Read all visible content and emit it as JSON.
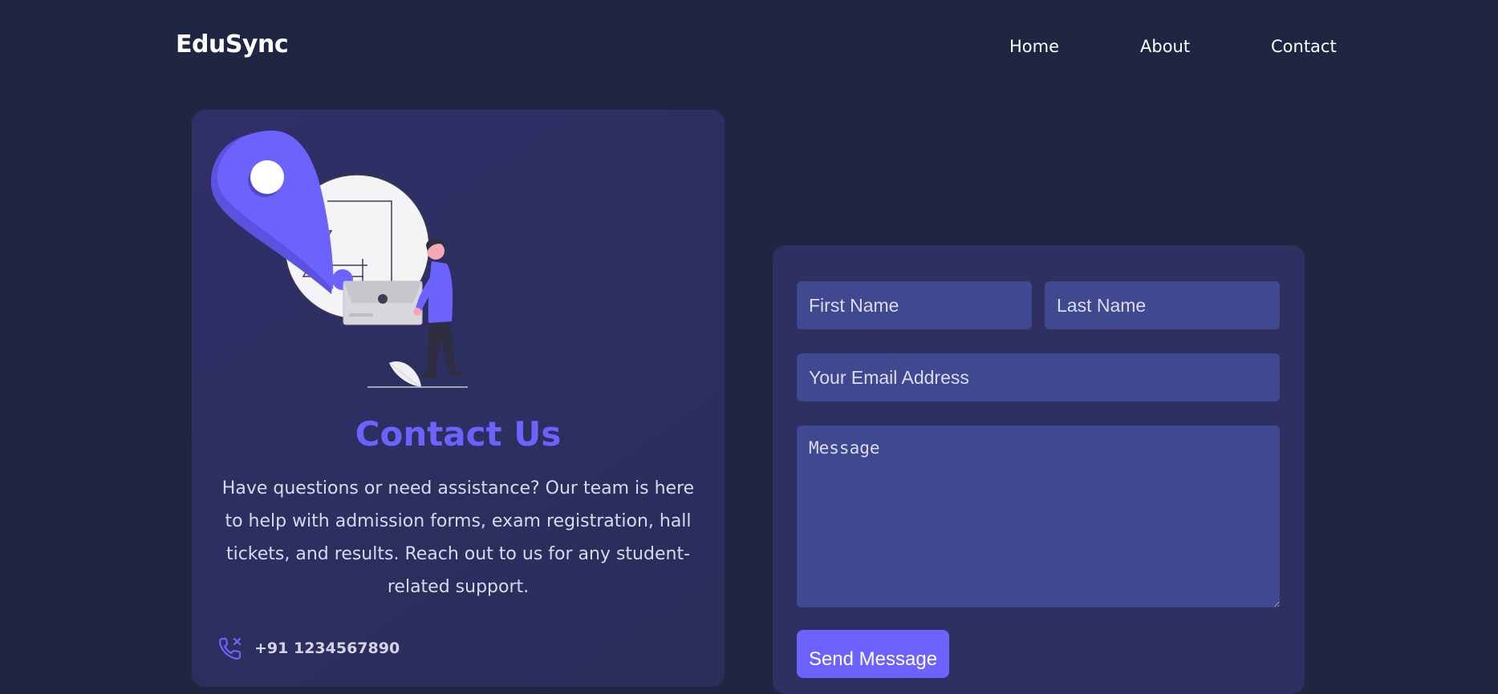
{
  "header": {
    "brand": "EduSync",
    "nav": [
      {
        "label": "Home"
      },
      {
        "label": "About"
      },
      {
        "label": "Contact"
      }
    ]
  },
  "contact_card": {
    "title": "Contact Us",
    "description": "Have questions or need assistance? Our team is here to help with admission forms, exam registration, hall tickets, and results. Reach out to us for any student-related support.",
    "phone": "+91 1234567890",
    "illustration_icon": "location-pin-illustration",
    "phone_icon": "phone-call-icon"
  },
  "form": {
    "first_name_placeholder": "First Name",
    "last_name_placeholder": "Last Name",
    "email_placeholder": "Your Email Address",
    "message_placeholder": "Message",
    "submit_label": "Send Message"
  },
  "colors": {
    "background": "#1f2642",
    "card": "#2d3061",
    "input": "#404890",
    "accent": "#6c63ff"
  }
}
